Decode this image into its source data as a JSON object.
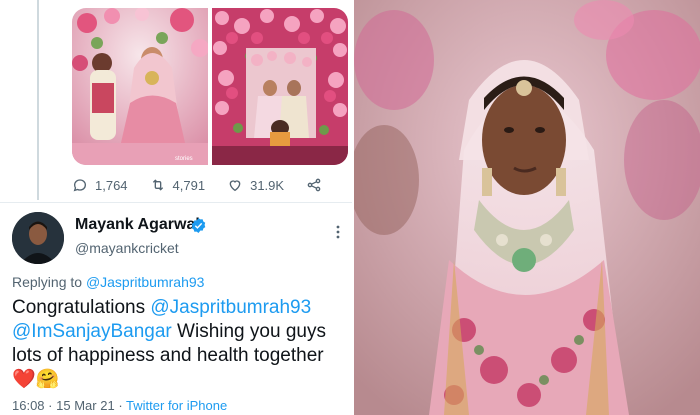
{
  "tweet": {
    "stats": {
      "replies": "1,764",
      "retweets": "4,791",
      "likes": "31.9K"
    },
    "media_watermark": "stories"
  },
  "reply_tweet": {
    "display_name": "Mayank Agarwal",
    "handle": "@mayankcricket",
    "replying_to_label": "Replying to",
    "replying_to_handle": "@Jaspritbumrah93",
    "body": {
      "word_congrats": "Congratulations",
      "mention_1": "@Jaspritbumrah93",
      "mention_2": "@ImSanjayBangar",
      "text_rest": "Wishing you guys lots of happiness and health together",
      "emojis": "❤️🤗"
    },
    "time": "16:08",
    "dot": "·",
    "date": "15 Mar 21",
    "source": "Twitter for iPhone"
  },
  "colors": {
    "link": "#1d9bf0",
    "secondary_text": "#536471",
    "primary_text": "#0f1419",
    "verified": "#1d9bf0"
  }
}
